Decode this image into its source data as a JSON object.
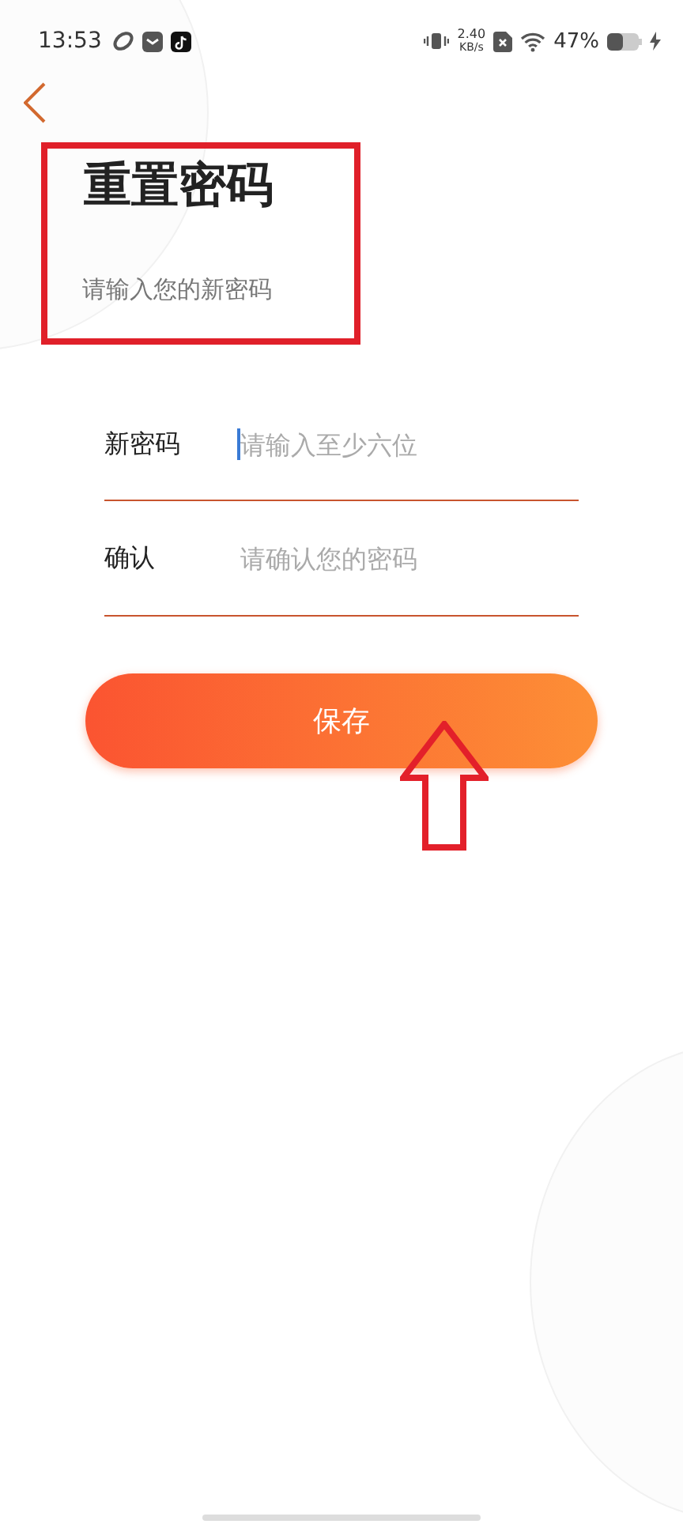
{
  "status_bar": {
    "time": "13:53",
    "speed": "2.40",
    "speed_unit": "KB/s",
    "battery": "47%"
  },
  "title": "重置密码",
  "subtitle": "请输入您的新密码",
  "fields": [
    {
      "label": "新密码",
      "placeholder": "请输入至少六位",
      "focused": true
    },
    {
      "label": "确认",
      "placeholder": "请确认您的密码",
      "focused": false
    }
  ],
  "button": "保存"
}
